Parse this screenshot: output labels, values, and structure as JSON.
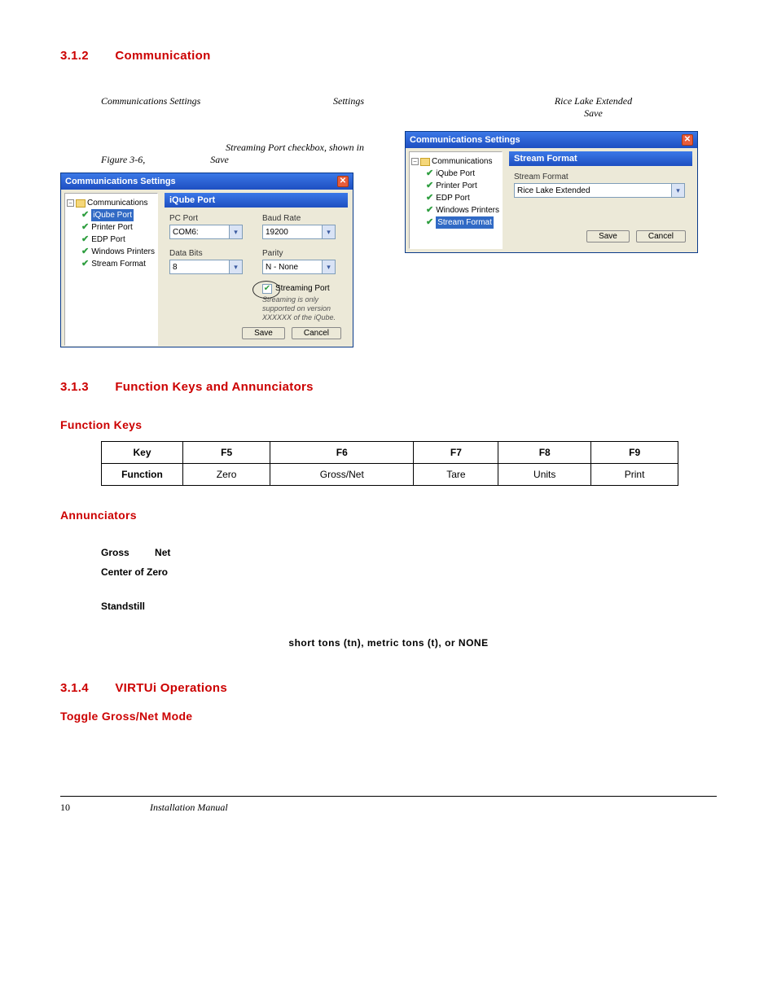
{
  "section312": {
    "num": "3.1.2",
    "title": "Communication"
  },
  "leftCol": {
    "line1a": "Communications Settings",
    "line1b": "Settings",
    "line2a": "Figure 3-6,",
    "line2b": "Streaming Port checkbox, shown in",
    "line2c": "Save"
  },
  "rightCol": {
    "line1": "Rice Lake Extended",
    "line2": "Save"
  },
  "dialog1": {
    "title": "Communications Settings",
    "tree": {
      "root": "Communications",
      "items": [
        "iQube Port",
        "Printer Port",
        "EDP Port",
        "Windows Printers",
        "Stream Format"
      ],
      "selected": "iQube Port"
    },
    "panelTitle": "iQube Port",
    "pcPort": {
      "label": "PC Port",
      "value": "COM6:"
    },
    "baud": {
      "label": "Baud Rate",
      "value": "19200"
    },
    "dataBits": {
      "label": "Data Bits",
      "value": "8"
    },
    "parity": {
      "label": "Parity",
      "value": "N - None"
    },
    "streamChk": {
      "label": "Streaming Port",
      "checked": true
    },
    "hint": "Streaming is only supported on version XXXXXX of the iQube.",
    "btnSave": "Save",
    "btnCancel": "Cancel"
  },
  "dialog2": {
    "title": "Communications Settings",
    "tree": {
      "root": "Communications",
      "items": [
        "iQube Port",
        "Printer Port",
        "EDP Port",
        "Windows Printers",
        "Stream Format"
      ],
      "selected": "Stream Format"
    },
    "panelTitle": "Stream Format",
    "fmtLabel": "Stream Format",
    "fmtValue": "Rice Lake Extended",
    "btnSave": "Save",
    "btnCancel": "Cancel"
  },
  "section313": {
    "num": "3.1.3",
    "title": "Function Keys and Annunciators"
  },
  "fk_heading": "Function Keys",
  "keytable": {
    "headers": [
      "Key",
      "F5",
      "F6",
      "F7",
      "F8",
      "F9"
    ],
    "row2": [
      "Function",
      "Zero",
      "Gross/Net",
      "Tare",
      "Units",
      "Print"
    ]
  },
  "ann_heading": "Annunciators",
  "ann": {
    "gross": "Gross",
    "net": "Net",
    "coz": "Center of Zero",
    "stand": "Standstill"
  },
  "unitsLine": "short tons (tn), metric tons (t), or NONE",
  "section314": {
    "num": "3.1.4",
    "title": "VIRTUi Operations"
  },
  "toggleHeading": "Toggle Gross/Net Mode",
  "footer": {
    "page": "10",
    "label": "Installation Manual"
  }
}
